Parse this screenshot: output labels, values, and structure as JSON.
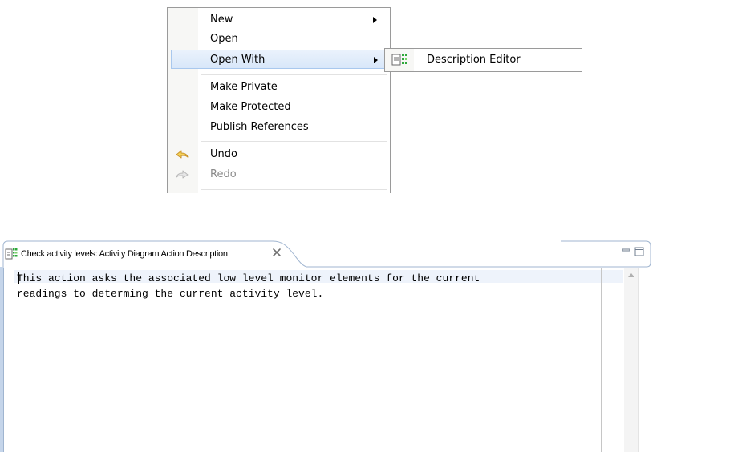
{
  "context_menu": {
    "items": [
      {
        "label": "New",
        "submenu": true
      },
      {
        "label": "Open",
        "submenu": false
      },
      {
        "label": "Open With",
        "submenu": true,
        "highlighted": true
      },
      {
        "label": "Make Private"
      },
      {
        "label": "Make Protected"
      },
      {
        "label": "Publish References"
      },
      {
        "label": "Undo",
        "icon": "undo-arrow-icon"
      },
      {
        "label": "Redo",
        "icon": "redo-arrow-icon",
        "disabled": true
      }
    ]
  },
  "submenu": {
    "items": [
      {
        "label": "Description Editor",
        "icon": "description-editor-icon"
      }
    ]
  },
  "editor": {
    "tab_title": "Check activity levels: Activity Diagram Action Description",
    "tab_icon": "description-editor-icon",
    "lines": [
      "This action asks the associated low level monitor elements for the current",
      "readings to determing the current activity level."
    ]
  },
  "colors": {
    "menu_highlight": "#d8e7f9",
    "menu_highlight_border": "#a9c8ee",
    "undo_icon": "#f0c33c",
    "redo_icon_disabled": "#c8c8c8",
    "current_line": "#eef3fb",
    "view_border": "#a0b5d0"
  }
}
